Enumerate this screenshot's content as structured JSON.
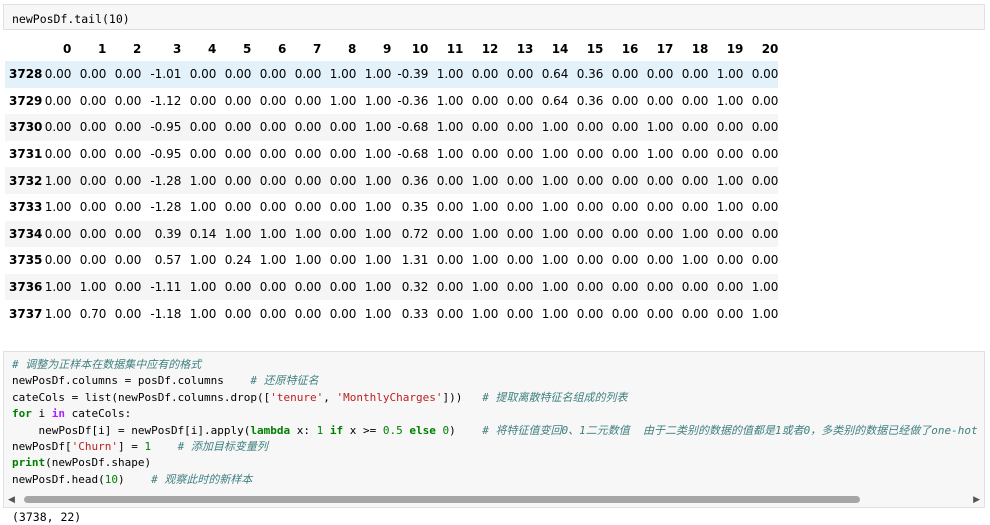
{
  "cell1": {
    "input": "newPosDf.tail(10)"
  },
  "table": {
    "columns": [
      "0",
      "1",
      "2",
      "3",
      "4",
      "5",
      "6",
      "7",
      "8",
      "9",
      "10",
      "11",
      "12",
      "13",
      "14",
      "15",
      "16",
      "17",
      "18",
      "19",
      "20"
    ],
    "rows": [
      {
        "index": "3728",
        "values": [
          "0.00",
          "0.00",
          "0.00",
          "-1.01",
          "0.00",
          "0.00",
          "0.00",
          "0.00",
          "1.00",
          "1.00",
          "-0.39",
          "1.00",
          "0.00",
          "0.00",
          "0.64",
          "0.36",
          "0.00",
          "0.00",
          "0.00",
          "1.00",
          "0.00"
        ]
      },
      {
        "index": "3729",
        "values": [
          "0.00",
          "0.00",
          "0.00",
          "-1.12",
          "0.00",
          "0.00",
          "0.00",
          "0.00",
          "1.00",
          "1.00",
          "-0.36",
          "1.00",
          "0.00",
          "0.00",
          "0.64",
          "0.36",
          "0.00",
          "0.00",
          "0.00",
          "1.00",
          "0.00"
        ]
      },
      {
        "index": "3730",
        "values": [
          "0.00",
          "0.00",
          "0.00",
          "-0.95",
          "0.00",
          "0.00",
          "0.00",
          "0.00",
          "0.00",
          "1.00",
          "-0.68",
          "1.00",
          "0.00",
          "0.00",
          "1.00",
          "0.00",
          "0.00",
          "1.00",
          "0.00",
          "0.00",
          "0.00"
        ]
      },
      {
        "index": "3731",
        "values": [
          "0.00",
          "0.00",
          "0.00",
          "-0.95",
          "0.00",
          "0.00",
          "0.00",
          "0.00",
          "0.00",
          "1.00",
          "-0.68",
          "1.00",
          "0.00",
          "0.00",
          "1.00",
          "0.00",
          "0.00",
          "1.00",
          "0.00",
          "0.00",
          "0.00"
        ]
      },
      {
        "index": "3732",
        "values": [
          "1.00",
          "0.00",
          "0.00",
          "-1.28",
          "1.00",
          "0.00",
          "0.00",
          "0.00",
          "0.00",
          "1.00",
          "0.36",
          "0.00",
          "1.00",
          "0.00",
          "1.00",
          "0.00",
          "0.00",
          "0.00",
          "0.00",
          "1.00",
          "0.00"
        ]
      },
      {
        "index": "3733",
        "values": [
          "1.00",
          "0.00",
          "0.00",
          "-1.28",
          "1.00",
          "0.00",
          "0.00",
          "0.00",
          "0.00",
          "1.00",
          "0.35",
          "0.00",
          "1.00",
          "0.00",
          "1.00",
          "0.00",
          "0.00",
          "0.00",
          "0.00",
          "1.00",
          "0.00"
        ]
      },
      {
        "index": "3734",
        "values": [
          "0.00",
          "0.00",
          "0.00",
          "0.39",
          "0.14",
          "1.00",
          "1.00",
          "1.00",
          "0.00",
          "1.00",
          "0.72",
          "0.00",
          "1.00",
          "0.00",
          "1.00",
          "0.00",
          "0.00",
          "0.00",
          "1.00",
          "0.00",
          "0.00"
        ]
      },
      {
        "index": "3735",
        "values": [
          "0.00",
          "0.00",
          "0.00",
          "0.57",
          "1.00",
          "0.24",
          "1.00",
          "1.00",
          "0.00",
          "1.00",
          "1.31",
          "0.00",
          "1.00",
          "0.00",
          "1.00",
          "0.00",
          "0.00",
          "0.00",
          "1.00",
          "0.00",
          "0.00"
        ]
      },
      {
        "index": "3736",
        "values": [
          "1.00",
          "1.00",
          "0.00",
          "-1.11",
          "1.00",
          "0.00",
          "0.00",
          "0.00",
          "0.00",
          "1.00",
          "0.32",
          "0.00",
          "1.00",
          "0.00",
          "1.00",
          "0.00",
          "0.00",
          "0.00",
          "0.00",
          "0.00",
          "1.00"
        ]
      },
      {
        "index": "3737",
        "values": [
          "1.00",
          "0.70",
          "0.00",
          "-1.18",
          "1.00",
          "0.00",
          "0.00",
          "0.00",
          "0.00",
          "1.00",
          "0.33",
          "0.00",
          "1.00",
          "0.00",
          "1.00",
          "0.00",
          "0.00",
          "0.00",
          "0.00",
          "0.00",
          "1.00"
        ]
      }
    ]
  },
  "cell2": {
    "comment1": "# 调整为正样本在数据集中应有的格式",
    "line2_code": "newPosDf.columns = posDf.columns",
    "line2_comment": "# 还原特征名",
    "line3_a": "cateCols = list(newPosDf.columns.drop([",
    "line3_s1": "'tenure'",
    "line3_b": ", ",
    "line3_s2": "'MonthlyCharges'",
    "line3_c": "]))",
    "line3_comment": "# 提取离散特征名组成的列表",
    "line4_for": "for",
    "line4_a": " i ",
    "line4_in": "in",
    "line4_b": " cateCols:",
    "line5_a": "    newPosDf[i] = newPosDf[i].apply(",
    "line5_lambda": "lambda",
    "line5_b": " x: ",
    "line5_n1": "1",
    "line5_if": "if",
    "line5_c": " x >= ",
    "line5_n2": "0.5",
    "line5_else": "else",
    "line5_n3": "0",
    "line5_d": ")",
    "line5_comment": "# 将特征值变回0、1二元数值  由于二类别的数据的值都是1或者0，多类别的数据已经做了one-hot",
    "line6_a": "newPosDf[",
    "line6_s": "'Churn'",
    "line6_b": "] = ",
    "line6_n": "1",
    "line6_comment": "# 添加目标变量列",
    "line7_print": "print",
    "line7_a": "(newPosDf.shape)",
    "line8_a": "newPosDf.head(",
    "line8_n": "10",
    "line8_b": ")",
    "line8_comment": "# 观察此时的新样本",
    "output": "(3738, 22)"
  },
  "icons": {
    "scroll_left": "◀",
    "scroll_right": "▶"
  }
}
